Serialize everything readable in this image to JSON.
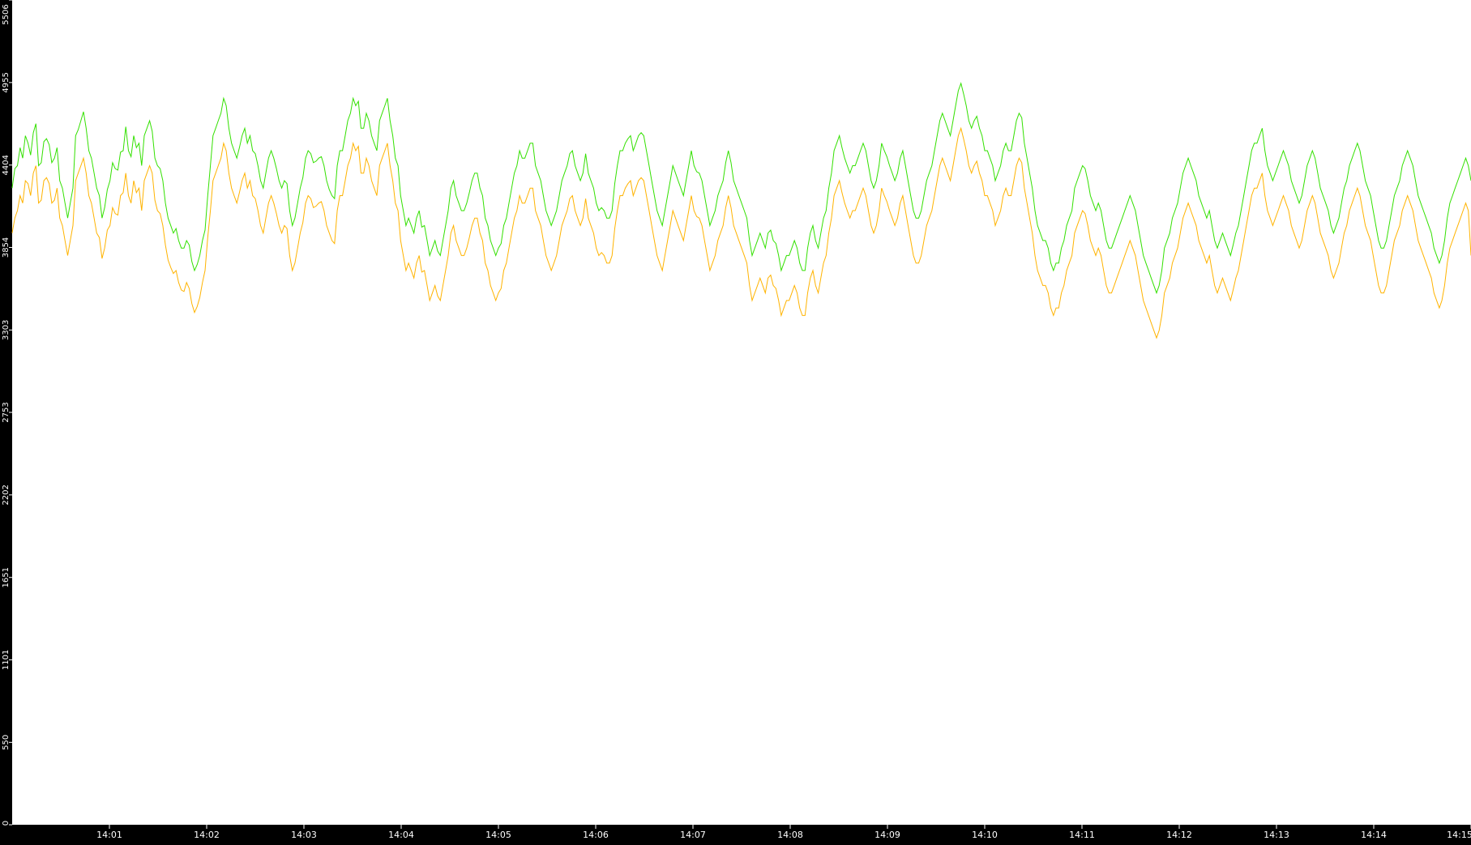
{
  "chart_data": {
    "type": "line",
    "title": "",
    "xlabel": "",
    "ylabel": "",
    "x_start": "14:00:00",
    "x_end": "14:15:00",
    "xlim": [
      "14:00:00",
      "14:15:00"
    ],
    "ylim": [
      0,
      5506
    ],
    "yticks": [
      0,
      550,
      1101,
      1651,
      2202,
      2753,
      3303,
      3854,
      4404,
      4955,
      5506
    ],
    "xticks": [
      "14:01",
      "14:02",
      "14:03",
      "14:04",
      "14:05",
      "14:06",
      "14:07",
      "14:08",
      "14:09",
      "14:10",
      "14:11",
      "14:12",
      "14:13",
      "14:14",
      "14:15"
    ],
    "grid": false,
    "legend": "none",
    "colors": {
      "background": "#ffffff",
      "frame": "#000000",
      "tick_text": "#ffffff"
    },
    "series": [
      {
        "color": "#33e000",
        "values": [
          4250,
          4380,
          4400,
          4520,
          4450,
          4600,
          4550,
          4470,
          4620,
          4680,
          4400,
          4420,
          4560,
          4580,
          4540,
          4420,
          4450,
          4520,
          4300,
          4250,
          4150,
          4050,
          4150,
          4250,
          4600,
          4640,
          4700,
          4760,
          4650,
          4500,
          4450,
          4350,
          4250,
          4200,
          4050,
          4120,
          4240,
          4300,
          4420,
          4380,
          4370,
          4490,
          4500,
          4660,
          4500,
          4460,
          4600,
          4520,
          4550,
          4400,
          4600,
          4650,
          4700,
          4630,
          4450,
          4400,
          4380,
          4300,
          4150,
          4050,
          4000,
          3950,
          3980,
          3900,
          3850,
          3850,
          3900,
          3870,
          3760,
          3700,
          3740,
          3800,
          3900,
          3970,
          4200,
          4400,
          4600,
          4650,
          4700,
          4750,
          4850,
          4800,
          4650,
          4550,
          4500,
          4450,
          4520,
          4600,
          4650,
          4550,
          4600,
          4500,
          4480,
          4400,
          4300,
          4250,
          4350,
          4450,
          4500,
          4450,
          4380,
          4300,
          4250,
          4300,
          4280,
          4100,
          4000,
          4050,
          4150,
          4250,
          4320,
          4450,
          4500,
          4480,
          4420,
          4430,
          4450,
          4460,
          4400,
          4300,
          4240,
          4200,
          4180,
          4400,
          4500,
          4500,
          4600,
          4700,
          4750,
          4850,
          4800,
          4830,
          4650,
          4650,
          4750,
          4700,
          4600,
          4550,
          4500,
          4700,
          4750,
          4800,
          4850,
          4700,
          4600,
          4450,
          4400,
          4200,
          4100,
          4000,
          4050,
          4000,
          3950,
          4050,
          4100,
          3990,
          4000,
          3900,
          3800,
          3850,
          3900,
          3830,
          3800,
          3900,
          4000,
          4100,
          4250,
          4300,
          4200,
          4150,
          4100,
          4100,
          4150,
          4220,
          4300,
          4350,
          4350,
          4250,
          4200,
          4050,
          4000,
          3900,
          3850,
          3800,
          3850,
          3880,
          4000,
          4050,
          4150,
          4250,
          4350,
          4400,
          4500,
          4450,
          4450,
          4500,
          4550,
          4550,
          4400,
          4350,
          4300,
          4200,
          4100,
          4050,
          4000,
          4050,
          4100,
          4200,
          4300,
          4350,
          4400,
          4480,
          4500,
          4400,
          4350,
          4300,
          4350,
          4480,
          4350,
          4300,
          4250,
          4150,
          4100,
          4120,
          4100,
          4050,
          4050,
          4100,
          4280,
          4400,
          4500,
          4500,
          4550,
          4580,
          4600,
          4500,
          4550,
          4600,
          4620,
          4600,
          4500,
          4400,
          4300,
          4200,
          4100,
          4050,
          4000,
          4100,
          4200,
          4300,
          4400,
          4350,
          4300,
          4250,
          4200,
          4300,
          4400,
          4500,
          4400,
          4360,
          4350,
          4300,
          4200,
          4100,
          4000,
          4050,
          4100,
          4200,
          4250,
          4300,
          4420,
          4500,
          4420,
          4300,
          4250,
          4200,
          4150,
          4100,
          4050,
          3900,
          3800,
          3850,
          3900,
          3950,
          3900,
          3850,
          3950,
          3970,
          3900,
          3880,
          3800,
          3700,
          3750,
          3800,
          3800,
          3850,
          3900,
          3850,
          3750,
          3700,
          3700,
          3850,
          3950,
          4000,
          3900,
          3850,
          3950,
          4050,
          4100,
          4250,
          4350,
          4500,
          4550,
          4600,
          4520,
          4450,
          4400,
          4350,
          4400,
          4400,
          4450,
          4500,
          4550,
          4500,
          4400,
          4300,
          4250,
          4300,
          4400,
          4550,
          4500,
          4460,
          4400,
          4350,
          4300,
          4350,
          4450,
          4500,
          4400,
          4300,
          4200,
          4100,
          4050,
          4050,
          4100,
          4200,
          4300,
          4350,
          4400,
          4500,
          4600,
          4700,
          4750,
          4700,
          4650,
          4600,
          4700,
          4800,
          4900,
          4950,
          4880,
          4800,
          4700,
          4650,
          4700,
          4730,
          4650,
          4600,
          4500,
          4500,
          4450,
          4400,
          4300,
          4350,
          4400,
          4500,
          4550,
          4500,
          4500,
          4600,
          4700,
          4750,
          4720,
          4550,
          4450,
          4350,
          4250,
          4100,
          4000,
          3950,
          3900,
          3900,
          3850,
          3750,
          3700,
          3750,
          3750,
          3850,
          3900,
          4000,
          4050,
          4100,
          4250,
          4300,
          4350,
          4400,
          4380,
          4300,
          4200,
          4150,
          4100,
          4150,
          4100,
          4000,
          3900,
          3850,
          3850,
          3900,
          3950,
          4000,
          4050,
          4100,
          4150,
          4200,
          4150,
          4100,
          4000,
          3900,
          3800,
          3750,
          3700,
          3650,
          3600,
          3550,
          3600,
          3700,
          3850,
          3900,
          3950,
          4050,
          4100,
          4150,
          4250,
          4350,
          4400,
          4450,
          4400,
          4350,
          4300,
          4200,
          4150,
          4100,
          4050,
          4100,
          4000,
          3900,
          3850,
          3900,
          3950,
          3900,
          3850,
          3800,
          3870,
          3950,
          4000,
          4100,
          4200,
          4300,
          4400,
          4500,
          4550,
          4550,
          4600,
          4650,
          4500,
          4400,
          4350,
          4300,
          4350,
          4400,
          4450,
          4500,
          4450,
          4400,
          4300,
          4250,
          4200,
          4150,
          4200,
          4300,
          4400,
          4450,
          4500,
          4450,
          4350,
          4250,
          4200,
          4150,
          4100,
          4000,
          3950,
          4000,
          4050,
          4150,
          4250,
          4300,
          4400,
          4450,
          4500,
          4550,
          4500,
          4400,
          4300,
          4250,
          4200,
          4100,
          4000,
          3900,
          3850,
          3850,
          3900,
          4000,
          4100,
          4200,
          4250,
          4300,
          4400,
          4450,
          4500,
          4450,
          4400,
          4300,
          4200,
          4150,
          4100,
          4050,
          4000,
          3950,
          3850,
          3800,
          3750,
          3800,
          3900,
          4050,
          4150,
          4200,
          4250,
          4300,
          4350,
          4400,
          4450,
          4400,
          4300
        ]
      },
      {
        "color": "#ffb300",
        "values": [
          3950,
          4050,
          4100,
          4200,
          4150,
          4300,
          4280,
          4200,
          4350,
          4400,
          4150,
          4170,
          4300,
          4320,
          4280,
          4150,
          4170,
          4250,
          4050,
          4000,
          3900,
          3800,
          3900,
          4000,
          4300,
          4350,
          4400,
          4450,
          4350,
          4200,
          4150,
          4050,
          3950,
          3920,
          3780,
          3850,
          3970,
          4000,
          4120,
          4080,
          4070,
          4200,
          4220,
          4350,
          4200,
          4150,
          4300,
          4220,
          4250,
          4100,
          4300,
          4350,
          4400,
          4350,
          4170,
          4100,
          4080,
          4000,
          3870,
          3770,
          3720,
          3680,
          3700,
          3620,
          3570,
          3560,
          3620,
          3580,
          3480,
          3420,
          3460,
          3520,
          3620,
          3700,
          3920,
          4100,
          4300,
          4350,
          4400,
          4450,
          4550,
          4500,
          4350,
          4250,
          4200,
          4150,
          4220,
          4300,
          4350,
          4250,
          4300,
          4200,
          4180,
          4100,
          4000,
          3950,
          4050,
          4150,
          4200,
          4150,
          4080,
          4000,
          3950,
          4000,
          3980,
          3800,
          3700,
          3750,
          3850,
          3950,
          4020,
          4150,
          4200,
          4180,
          4120,
          4130,
          4150,
          4160,
          4100,
          4000,
          3950,
          3900,
          3880,
          4100,
          4200,
          4200,
          4300,
          4400,
          4450,
          4550,
          4500,
          4530,
          4350,
          4350,
          4450,
          4400,
          4300,
          4250,
          4200,
          4400,
          4450,
          4500,
          4550,
          4400,
          4300,
          4150,
          4100,
          3900,
          3800,
          3700,
          3750,
          3700,
          3650,
          3750,
          3800,
          3690,
          3700,
          3600,
          3500,
          3550,
          3600,
          3530,
          3500,
          3600,
          3700,
          3800,
          3950,
          4000,
          3900,
          3850,
          3800,
          3800,
          3850,
          3920,
          4000,
          4050,
          4050,
          3950,
          3900,
          3750,
          3700,
          3600,
          3550,
          3500,
          3550,
          3580,
          3700,
          3750,
          3850,
          3950,
          4050,
          4100,
          4200,
          4150,
          4150,
          4200,
          4250,
          4250,
          4100,
          4050,
          4000,
          3900,
          3800,
          3750,
          3700,
          3750,
          3800,
          3900,
          4000,
          4050,
          4100,
          4180,
          4200,
          4100,
          4050,
          4000,
          4050,
          4180,
          4050,
          4000,
          3950,
          3850,
          3800,
          3820,
          3800,
          3750,
          3750,
          3800,
          3980,
          4100,
          4200,
          4200,
          4250,
          4280,
          4300,
          4200,
          4250,
          4300,
          4320,
          4300,
          4200,
          4100,
          4000,
          3900,
          3800,
          3750,
          3700,
          3800,
          3900,
          4000,
          4100,
          4050,
          4000,
          3950,
          3900,
          4000,
          4100,
          4200,
          4100,
          4060,
          4050,
          4000,
          3900,
          3800,
          3700,
          3750,
          3800,
          3900,
          3950,
          4000,
          4120,
          4200,
          4120,
          4000,
          3950,
          3900,
          3850,
          3800,
          3750,
          3600,
          3500,
          3550,
          3600,
          3650,
          3600,
          3550,
          3650,
          3670,
          3600,
          3580,
          3500,
          3400,
          3450,
          3500,
          3500,
          3550,
          3600,
          3550,
          3450,
          3400,
          3400,
          3550,
          3650,
          3700,
          3600,
          3550,
          3650,
          3750,
          3800,
          3950,
          4050,
          4200,
          4250,
          4300,
          4220,
          4150,
          4100,
          4050,
          4100,
          4100,
          4150,
          4200,
          4250,
          4200,
          4100,
          4000,
          3950,
          4000,
          4100,
          4250,
          4200,
          4160,
          4100,
          4050,
          4000,
          4050,
          4150,
          4200,
          4100,
          4000,
          3900,
          3800,
          3750,
          3750,
          3800,
          3900,
          4000,
          4050,
          4100,
          4200,
          4300,
          4400,
          4450,
          4400,
          4350,
          4300,
          4400,
          4500,
          4600,
          4650,
          4580,
          4500,
          4400,
          4350,
          4400,
          4430,
          4350,
          4300,
          4200,
          4200,
          4150,
          4100,
          4000,
          4050,
          4100,
          4200,
          4250,
          4200,
          4200,
          4300,
          4400,
          4450,
          4420,
          4250,
          4150,
          4050,
          3950,
          3800,
          3700,
          3650,
          3600,
          3600,
          3550,
          3450,
          3400,
          3450,
          3450,
          3550,
          3600,
          3700,
          3750,
          3800,
          3950,
          4000,
          4050,
          4100,
          4080,
          4000,
          3900,
          3850,
          3800,
          3850,
          3800,
          3700,
          3600,
          3550,
          3550,
          3600,
          3650,
          3700,
          3750,
          3800,
          3850,
          3900,
          3850,
          3800,
          3700,
          3600,
          3500,
          3450,
          3400,
          3350,
          3300,
          3250,
          3300,
          3400,
          3550,
          3600,
          3650,
          3750,
          3800,
          3850,
          3950,
          4050,
          4100,
          4150,
          4100,
          4050,
          4000,
          3900,
          3850,
          3800,
          3750,
          3800,
          3700,
          3600,
          3550,
          3600,
          3650,
          3600,
          3550,
          3500,
          3570,
          3650,
          3700,
          3800,
          3900,
          4000,
          4100,
          4200,
          4250,
          4250,
          4300,
          4350,
          4200,
          4100,
          4050,
          4000,
          4050,
          4100,
          4150,
          4200,
          4150,
          4100,
          4000,
          3950,
          3900,
          3850,
          3900,
          4000,
          4100,
          4150,
          4200,
          4150,
          4050,
          3950,
          3900,
          3850,
          3800,
          3700,
          3650,
          3700,
          3750,
          3850,
          3950,
          4000,
          4100,
          4150,
          4200,
          4250,
          4200,
          4100,
          4000,
          3950,
          3900,
          3800,
          3700,
          3600,
          3550,
          3550,
          3600,
          3700,
          3800,
          3900,
          3950,
          4000,
          4100,
          4150,
          4200,
          4150,
          4100,
          4000,
          3900,
          3850,
          3800,
          3750,
          3700,
          3650,
          3550,
          3500,
          3450,
          3500,
          3600,
          3750,
          3850,
          3900,
          3950,
          4000,
          4050,
          4100,
          4150,
          4100,
          3800
        ]
      }
    ]
  }
}
